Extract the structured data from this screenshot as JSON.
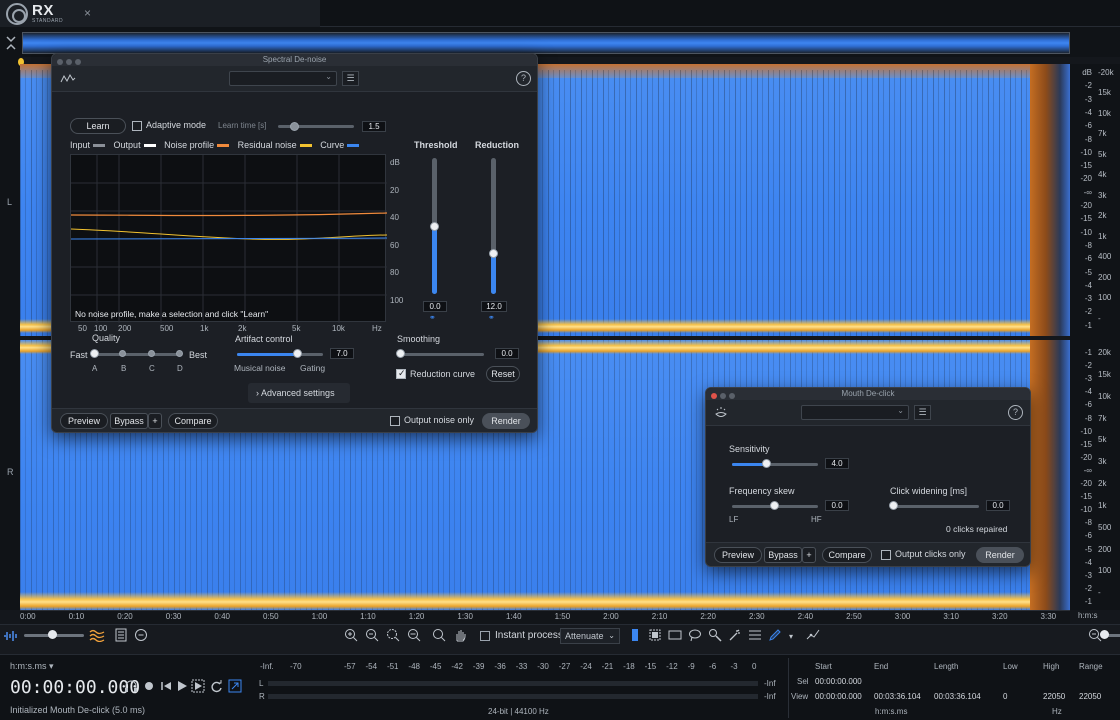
{
  "app": {
    "logo": "RX",
    "logo_sub": "STANDARD",
    "tab_close": "×"
  },
  "channels": {
    "left": "L",
    "right": "R"
  },
  "scale": {
    "db_top": [
      "dB",
      "-2",
      "-3",
      "-4",
      "-6",
      "-8",
      "-10",
      "-15",
      "-20",
      "-∞",
      "-20",
      "-15",
      "-10",
      "-8",
      "-6",
      "-5",
      "-4",
      "-3",
      "-2",
      "-1"
    ],
    "hz_top": [
      "-20k",
      "15k",
      "10k",
      "7k",
      "5k",
      "4k",
      "3k",
      "2k",
      "1k",
      "400",
      "200",
      "100",
      "-"
    ],
    "db_bot": [
      "-1",
      "-2",
      "-3",
      "-4",
      "-6",
      "-8",
      "-10",
      "-15",
      "-20",
      "-∞",
      "-20",
      "-15",
      "-10",
      "-8",
      "-6",
      "-5",
      "-4",
      "-3",
      "-2",
      "-1"
    ],
    "hz_bot": [
      "20k",
      "15k",
      "10k",
      "7k",
      "5k",
      "3k",
      "2k",
      "1k",
      "500",
      "200",
      "100",
      "-"
    ]
  },
  "timeline": {
    "ticks": [
      "0:00",
      "0:10",
      "0:20",
      "0:30",
      "0:40",
      "0:50",
      "1:00",
      "1:10",
      "1:20",
      "1:30",
      "1:40",
      "1:50",
      "2:00",
      "2:10",
      "2:20",
      "2:30",
      "2:40",
      "2:50",
      "3:00",
      "3:10",
      "3:20",
      "3:30"
    ],
    "unit": "h:m:s"
  },
  "toolbar": {
    "instant_process": "Instant process",
    "attenuate": "Attenuate"
  },
  "status": {
    "time_format": "h:m:s.ms ▾",
    "time_code": "00:00:00.000",
    "message": "Initialized Mouth De-click (5.0 ms)",
    "meter_scale": [
      "-Inf.",
      "-70",
      "-57",
      "-54",
      "-51",
      "-48",
      "-45",
      "-42",
      "-39",
      "-36",
      "-33",
      "-30",
      "-27",
      "-24",
      "-21",
      "-18",
      "-15",
      "-12",
      "-9",
      "-6",
      "-3",
      "0"
    ],
    "meter_l": "L",
    "meter_r": "R",
    "meter_inf": "-Inf",
    "bit_info": "24-bit | 44100 Hz",
    "info": {
      "start_lbl": "Start",
      "end_lbl": "End",
      "length_lbl": "Length",
      "low_lbl": "Low",
      "high_lbl": "High",
      "range_lbl": "Range",
      "sel_lbl": "Sel",
      "view_lbl": "View",
      "sel_start": "00:00:00.000",
      "view_start": "00:00:00.000",
      "view_end": "00:03:36.104",
      "view_length": "00:03:36.104",
      "low": "0",
      "high": "22050",
      "range": "22050",
      "unit_time": "h:m:s.ms",
      "unit_hz": "Hz"
    }
  },
  "spectral_denoise": {
    "title": "Spectral De-noise",
    "learn": "Learn",
    "adaptive_mode": "Adaptive mode",
    "learn_time_label": "Learn time [s]",
    "learn_time": "1.5",
    "legend": {
      "input": "Input",
      "output": "Output",
      "noise_profile": "Noise profile",
      "residual_noise": "Residual noise",
      "curve": "Curve",
      "colors": {
        "input": "#8b9098",
        "output": "#ffffff",
        "noise_profile": "#f08a3c",
        "residual_noise": "#f2c230",
        "curve": "#3b86f0"
      }
    },
    "graph_message": "No noise profile, make a selection and click \"Learn\"",
    "graph_db": [
      "dB",
      "20",
      "40",
      "60",
      "80",
      "100"
    ],
    "graph_hz": [
      "50",
      "100",
      "200",
      "500",
      "1k",
      "2k",
      "5k",
      "10k",
      "Hz"
    ],
    "threshold_label": "Threshold",
    "threshold": "0.0",
    "threshold_level": 0.5,
    "reduction_label": "Reduction",
    "reduction": "12.0",
    "reduction_level": 0.3,
    "quality_label": "Quality",
    "quality_fast": "Fast",
    "quality_best": "Best",
    "quality_options": [
      "A",
      "B",
      "C",
      "D"
    ],
    "artifact_label": "Artifact control",
    "artifact": "7.0",
    "artifact_level": 0.7,
    "musical_noise": "Musical noise",
    "gating": "Gating",
    "smoothing_label": "Smoothing",
    "smoothing": "0.0",
    "reduction_curve": "Reduction curve",
    "reset": "Reset",
    "advanced": "Advanced settings",
    "preview": "Preview",
    "bypass": "Bypass",
    "plus": "+",
    "compare": "Compare",
    "output_noise_only": "Output noise only",
    "render": "Render"
  },
  "mouth_declick": {
    "title": "Mouth De-click",
    "sensitivity_label": "Sensitivity",
    "sensitivity": "4.0",
    "sensitivity_level": 0.4,
    "freq_skew_label": "Frequency skew",
    "freq_skew": "0.0",
    "lf": "LF",
    "hf": "HF",
    "click_widening_label": "Click widening [ms]",
    "click_widening": "0.0",
    "clicks_repaired": "0 clicks repaired",
    "preview": "Preview",
    "bypass": "Bypass",
    "plus": "+",
    "compare": "Compare",
    "output_clicks_only": "Output clicks only",
    "render": "Render"
  }
}
